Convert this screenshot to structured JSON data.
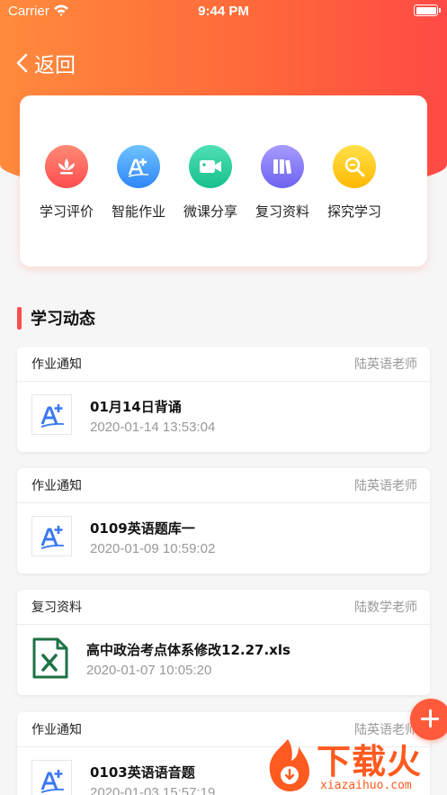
{
  "status_bar": {
    "carrier": "Carrier",
    "time": "9:44 PM"
  },
  "nav": {
    "back_label": "返回"
  },
  "shortcuts": [
    {
      "label": "学习评价",
      "icon": "lotus-icon",
      "color_from": "#ff8a75",
      "color_to": "#ff4d4f"
    },
    {
      "label": "智能作业",
      "icon": "homework-a-plus-icon",
      "color_from": "#6fc3ff",
      "color_to": "#2f86f6"
    },
    {
      "label": "微课分享",
      "icon": "video-camera-icon",
      "color_from": "#4fe0b5",
      "color_to": "#17bf8d"
    },
    {
      "label": "复习资料",
      "icon": "books-icon",
      "color_from": "#a79bff",
      "color_to": "#6c63f0"
    },
    {
      "label": "探究学习",
      "icon": "explore-magnifier-icon",
      "color_from": "#ffe14a",
      "color_to": "#ffb800"
    }
  ],
  "section": {
    "title": "学习动态"
  },
  "feed": [
    {
      "type": "作业通知",
      "teacher": "陆英语老师",
      "title": "01月14日背诵",
      "date": "2020-01-14 13:53:04",
      "icon": "homework-a-plus-icon"
    },
    {
      "type": "作业通知",
      "teacher": "陆英语老师",
      "title": "0109英语题库一",
      "date": "2020-01-09 10:59:02",
      "icon": "homework-a-plus-icon"
    },
    {
      "type": "复习资料",
      "teacher": "陆数学老师",
      "title": "高中政治考点体系修改12.27.xls",
      "date": "2020-01-07 10:05:20",
      "icon": "excel-file-icon"
    },
    {
      "type": "作业通知",
      "teacher": "陆英语老师",
      "title": "0103英语语音题",
      "date": "2020-01-03 15:57:19",
      "icon": "homework-a-plus-icon"
    }
  ],
  "watermark": {
    "brand": "下载火",
    "site": "xiazaihuo.com"
  },
  "colors": {
    "accent": "#ff5a3c",
    "section_bar": "#ff4d4f",
    "excel_green": "#1e7145"
  }
}
